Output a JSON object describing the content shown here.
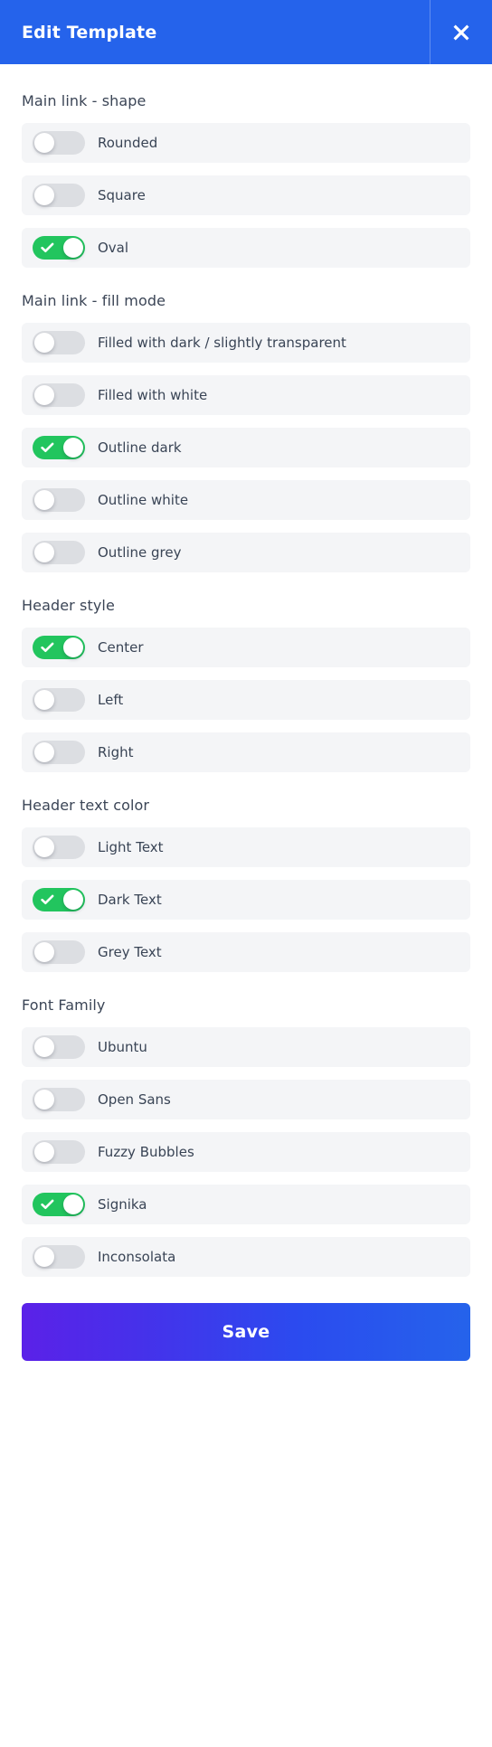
{
  "header": {
    "title": "Edit Template",
    "close_label": "×",
    "background_color": "#2563eb"
  },
  "colors": {
    "accent_blue": "#2563eb",
    "toggle_on": "#22c55e",
    "toggle_off": "#dcdee2",
    "row_background": "#f4f5f7",
    "text": "#394455",
    "save_gradient_start": "#5b21e8",
    "save_gradient_end": "#2563eb"
  },
  "sections": [
    {
      "title": "Main link - shape",
      "options": [
        {
          "label": "Rounded",
          "on": false
        },
        {
          "label": "Square",
          "on": false
        },
        {
          "label": "Oval",
          "on": true
        }
      ]
    },
    {
      "title": "Main link - fill mode",
      "options": [
        {
          "label": "Filled with dark / slightly transparent",
          "on": false
        },
        {
          "label": "Filled with white",
          "on": false
        },
        {
          "label": "Outline dark",
          "on": true
        },
        {
          "label": "Outline white",
          "on": false
        },
        {
          "label": "Outline grey",
          "on": false
        }
      ]
    },
    {
      "title": "Header style",
      "options": [
        {
          "label": "Center",
          "on": true
        },
        {
          "label": "Left",
          "on": false
        },
        {
          "label": "Right",
          "on": false
        }
      ]
    },
    {
      "title": "Header text color",
      "options": [
        {
          "label": "Light Text",
          "on": false
        },
        {
          "label": "Dark Text",
          "on": true
        },
        {
          "label": "Grey Text",
          "on": false
        }
      ]
    },
    {
      "title": "Font Family",
      "options": [
        {
          "label": "Ubuntu",
          "on": false
        },
        {
          "label": "Open Sans",
          "on": false
        },
        {
          "label": "Fuzzy Bubbles",
          "on": false
        },
        {
          "label": "Signika",
          "on": true
        },
        {
          "label": "Inconsolata",
          "on": false
        }
      ]
    }
  ],
  "footer": {
    "save_label": "Save"
  }
}
